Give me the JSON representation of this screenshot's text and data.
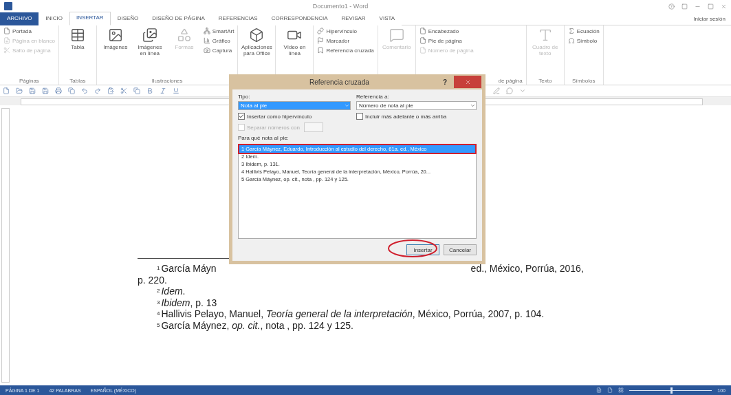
{
  "window": {
    "title": "Documento1 - Word",
    "signin": "Iniciar sesión"
  },
  "tabs": [
    {
      "label": "ARCHIVO",
      "kind": "file",
      "selected": false
    },
    {
      "label": "INICIO",
      "kind": "tab",
      "selected": false
    },
    {
      "label": "INSERTAR",
      "kind": "tab",
      "selected": true
    },
    {
      "label": "DISEÑO",
      "kind": "tab",
      "selected": false
    },
    {
      "label": "DISEÑO DE PÁGINA",
      "kind": "tab",
      "selected": false
    },
    {
      "label": "REFERENCIAS",
      "kind": "tab",
      "selected": false
    },
    {
      "label": "CORRESPONDENCIA",
      "kind": "tab",
      "selected": false
    },
    {
      "label": "REVISAR",
      "kind": "tab",
      "selected": false
    },
    {
      "label": "VISTA",
      "kind": "tab",
      "selected": false
    }
  ],
  "ribbon": {
    "groups": [
      {
        "label": "Páginas",
        "items": [
          {
            "label": "Portada",
            "kind": "small",
            "disabled": false
          },
          {
            "label": "Página en blanco",
            "kind": "small",
            "disabled": true
          },
          {
            "label": "Salto de página",
            "kind": "small",
            "disabled": true
          }
        ]
      },
      {
        "label": "Tablas",
        "items": [
          {
            "label": "Tabla",
            "kind": "large",
            "disabled": false
          }
        ]
      },
      {
        "label": "Ilustraciones",
        "items": [
          {
            "label": "Imágenes",
            "kind": "large",
            "disabled": false
          },
          {
            "label": "Imágenes en línea",
            "kind": "large",
            "disabled": false
          },
          {
            "label": "Formas",
            "kind": "large",
            "disabled": true
          },
          {
            "label": "SmartArt",
            "kind": "small",
            "disabled": false
          },
          {
            "label": "Gráfico",
            "kind": "small",
            "disabled": false
          },
          {
            "label": "Captura",
            "kind": "small",
            "disabled": false
          }
        ]
      },
      {
        "items": [
          {
            "label": "Aplicaciones para Office",
            "kind": "large",
            "disabled": false
          }
        ]
      },
      {
        "items": [
          {
            "label": "Vídeo en línea",
            "kind": "large",
            "disabled": false
          }
        ]
      },
      {
        "items": [
          {
            "label": "Hipervínculo",
            "kind": "small",
            "disabled": false
          },
          {
            "label": "Marcador",
            "kind": "small",
            "disabled": false
          },
          {
            "label": "Referencia cruzada",
            "kind": "small",
            "disabled": false
          }
        ]
      },
      {
        "items": [
          {
            "label": "Comentario",
            "kind": "large",
            "disabled": true
          }
        ]
      },
      {
        "label": "de página",
        "items": [
          {
            "label": "Encabezado",
            "kind": "small",
            "disabled": false
          },
          {
            "label": "Pie de página",
            "kind": "small",
            "disabled": false
          },
          {
            "label": "Número de página",
            "kind": "small",
            "disabled": true
          }
        ]
      },
      {
        "label": "Texto",
        "items": [
          {
            "label": "Cuadro de texto",
            "kind": "large",
            "disabled": true
          }
        ]
      },
      {
        "label": "Símbolos",
        "items": [
          {
            "label": "Ecuación",
            "kind": "small",
            "disabled": false
          },
          {
            "label": "Símbolo",
            "kind": "small",
            "disabled": false
          }
        ]
      }
    ]
  },
  "document": {
    "footnotes": [
      {
        "number": "1",
        "parts": [
          "García Máyn",
          "ed., México, Porrúa, 2016,"
        ],
        "continuation": "p. 220."
      },
      {
        "number": "2",
        "parts": [
          "*Idem*."
        ]
      },
      {
        "number": "3",
        "parts": [
          "*Ibidem*, p. 13"
        ]
      },
      {
        "number": "4",
        "parts": [
          "Hallivis Pelayo, Manuel, *Teoría general de la interpretación*, México, Porrúa, 2007, p. 104."
        ]
      },
      {
        "number": "5",
        "parts": [
          "García Máynez, *op. cit.*, nota , pp. 124 y 125."
        ]
      }
    ]
  },
  "dialog": {
    "title": "Referencia cruzada",
    "help": "?",
    "type": {
      "label": "Tipo:",
      "value": "Nota al pie"
    },
    "reference": {
      "label": "Referencia a:",
      "value": "Número de nota al pie"
    },
    "options": [
      {
        "label": "Insertar como hipervínculo",
        "checked": true,
        "disabled": false
      },
      {
        "label": "Incluir más adelante o más arriba",
        "checked": false,
        "disabled": false
      },
      {
        "label": "Separar números con",
        "checked": false,
        "disabled": true
      }
    ],
    "list_label": "Para qué nota al pie:",
    "items": [
      {
        "text": "1 García Máynez, Eduardo, Introducción al estudio del derecho, 61a. ed., México",
        "selected": true
      },
      {
        "text": "2 Idem.",
        "selected": false
      },
      {
        "text": "3 Ibidem, p. 131.",
        "selected": false
      },
      {
        "text": "4 Hallivis Pelayo, Manuel, Teoría general de la interpretación, México, Porrúa, 20...",
        "selected": false
      },
      {
        "text": "5 García Máynez, op. cit., nota , pp. 124 y 125.",
        "selected": false
      }
    ],
    "buttons": [
      "Insertar",
      "Cancelar"
    ]
  },
  "status_bar": {
    "items": [
      "PÁGINA 1 DE 1",
      "42 PALABRAS",
      "ESPAÑOL (MÉXICO)"
    ],
    "zoom": {
      "text": "100",
      "level": 0.5
    }
  }
}
